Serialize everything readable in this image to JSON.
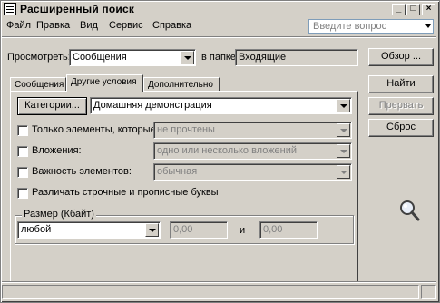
{
  "window": {
    "title": "Расширенный поиск"
  },
  "menubar": {
    "items": [
      "Файл",
      "Правка",
      "Вид",
      "Сервис",
      "Справка"
    ],
    "ask_placeholder": "Введите вопрос"
  },
  "look": {
    "label": "Просмотреть:",
    "value": "Сообщения",
    "in_folder_label": "в папке:",
    "folder": "Входящие",
    "browse_button": "Обзор ..."
  },
  "tabs": [
    "Сообщения",
    "Другие условия",
    "Дополнительно"
  ],
  "buttons": {
    "find": "Найти",
    "stop": "Прервать",
    "reset": "Сброс"
  },
  "categories": {
    "button": "Категории...",
    "value": "Домашняя демонстрация"
  },
  "conditions": [
    {
      "label": "Только элементы, которые:",
      "value": "не прочтены"
    },
    {
      "label": "Вложения:",
      "value": "одно или несколько вложений"
    },
    {
      "label": "Важность элементов:",
      "value": "обычная"
    }
  ],
  "case_sensitive_label": "Различать строчные и прописные буквы",
  "size": {
    "group_label": "Размер (Кбайт)",
    "mode": "любой",
    "from": "0,00",
    "and_label": "и",
    "to": "0,00"
  },
  "icons": {
    "window": "search-window-icon",
    "minimize": "minimize-icon",
    "maximize": "maximize-icon",
    "close": "close-icon",
    "magnifier": "magnifier-icon"
  }
}
